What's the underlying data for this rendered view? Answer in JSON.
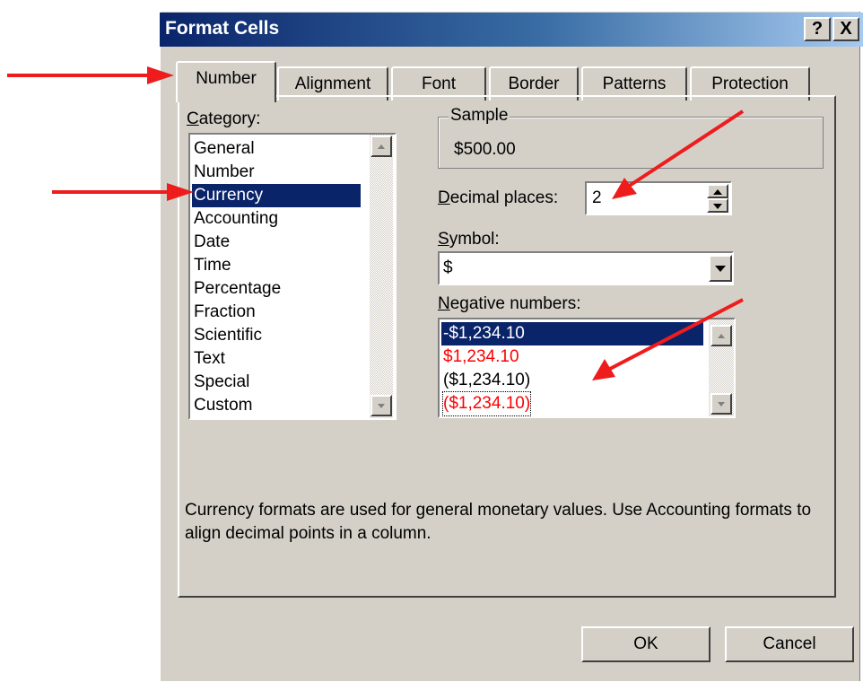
{
  "dialog": {
    "title": "Format Cells",
    "help_button": "?",
    "close_button": "X"
  },
  "tabs": [
    "Number",
    "Alignment",
    "Font",
    "Border",
    "Patterns",
    "Protection"
  ],
  "category": {
    "label": "Category:",
    "items": [
      "General",
      "Number",
      "Currency",
      "Accounting",
      "Date",
      "Time",
      "Percentage",
      "Fraction",
      "Scientific",
      "Text",
      "Special",
      "Custom"
    ],
    "selected": "Currency"
  },
  "sample": {
    "label": "Sample",
    "value": "$500.00"
  },
  "decimal_places": {
    "label": "Decimal places:",
    "value": "2"
  },
  "symbol": {
    "label": "Symbol:",
    "value": "$"
  },
  "negative_numbers": {
    "label": "Negative numbers:",
    "items": [
      "-$1,234.10",
      "$1,234.10",
      "($1,234.10)",
      "($1,234.10)"
    ],
    "selected": "-$1,234.10"
  },
  "description": "Currency formats are used for general monetary values.  Use Accounting formats to align decimal points in a column.",
  "buttons": {
    "ok": "OK",
    "cancel": "Cancel"
  },
  "colors": {
    "title_bar_start": "#0a246a",
    "selection": "#0a246a",
    "negative_red": "#ff0000",
    "annotation_arrow": "#ee1c1c",
    "dialog_face": "#d4d0c8"
  }
}
